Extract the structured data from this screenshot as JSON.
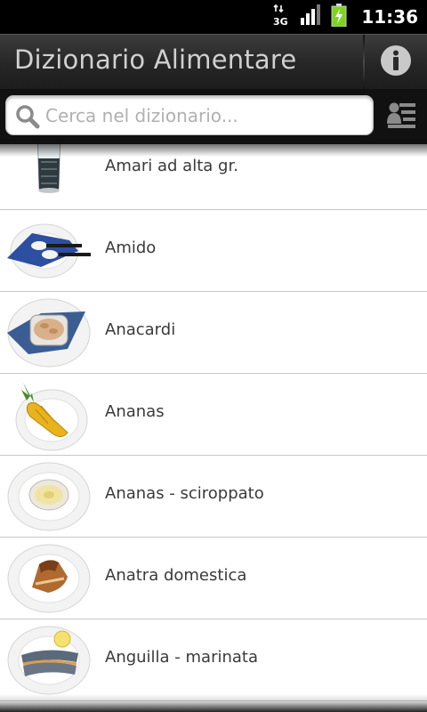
{
  "status_bar": {
    "network": "3G",
    "time": "11:36"
  },
  "header": {
    "title": "Dizionario Alimentare"
  },
  "search": {
    "placeholder": "Cerca nel dizionario..."
  },
  "items": [
    {
      "label": "Amari ad alta gr."
    },
    {
      "label": "Amido"
    },
    {
      "label": "Anacardi"
    },
    {
      "label": "Ananas"
    },
    {
      "label": "Ananas - sciroppato"
    },
    {
      "label": "Anatra domestica"
    },
    {
      "label": "Anguilla - marinata"
    }
  ],
  "colors": {
    "title_text": "#d0d0d0",
    "battery": "#7ed321",
    "item_text": "#3a3a3a"
  }
}
